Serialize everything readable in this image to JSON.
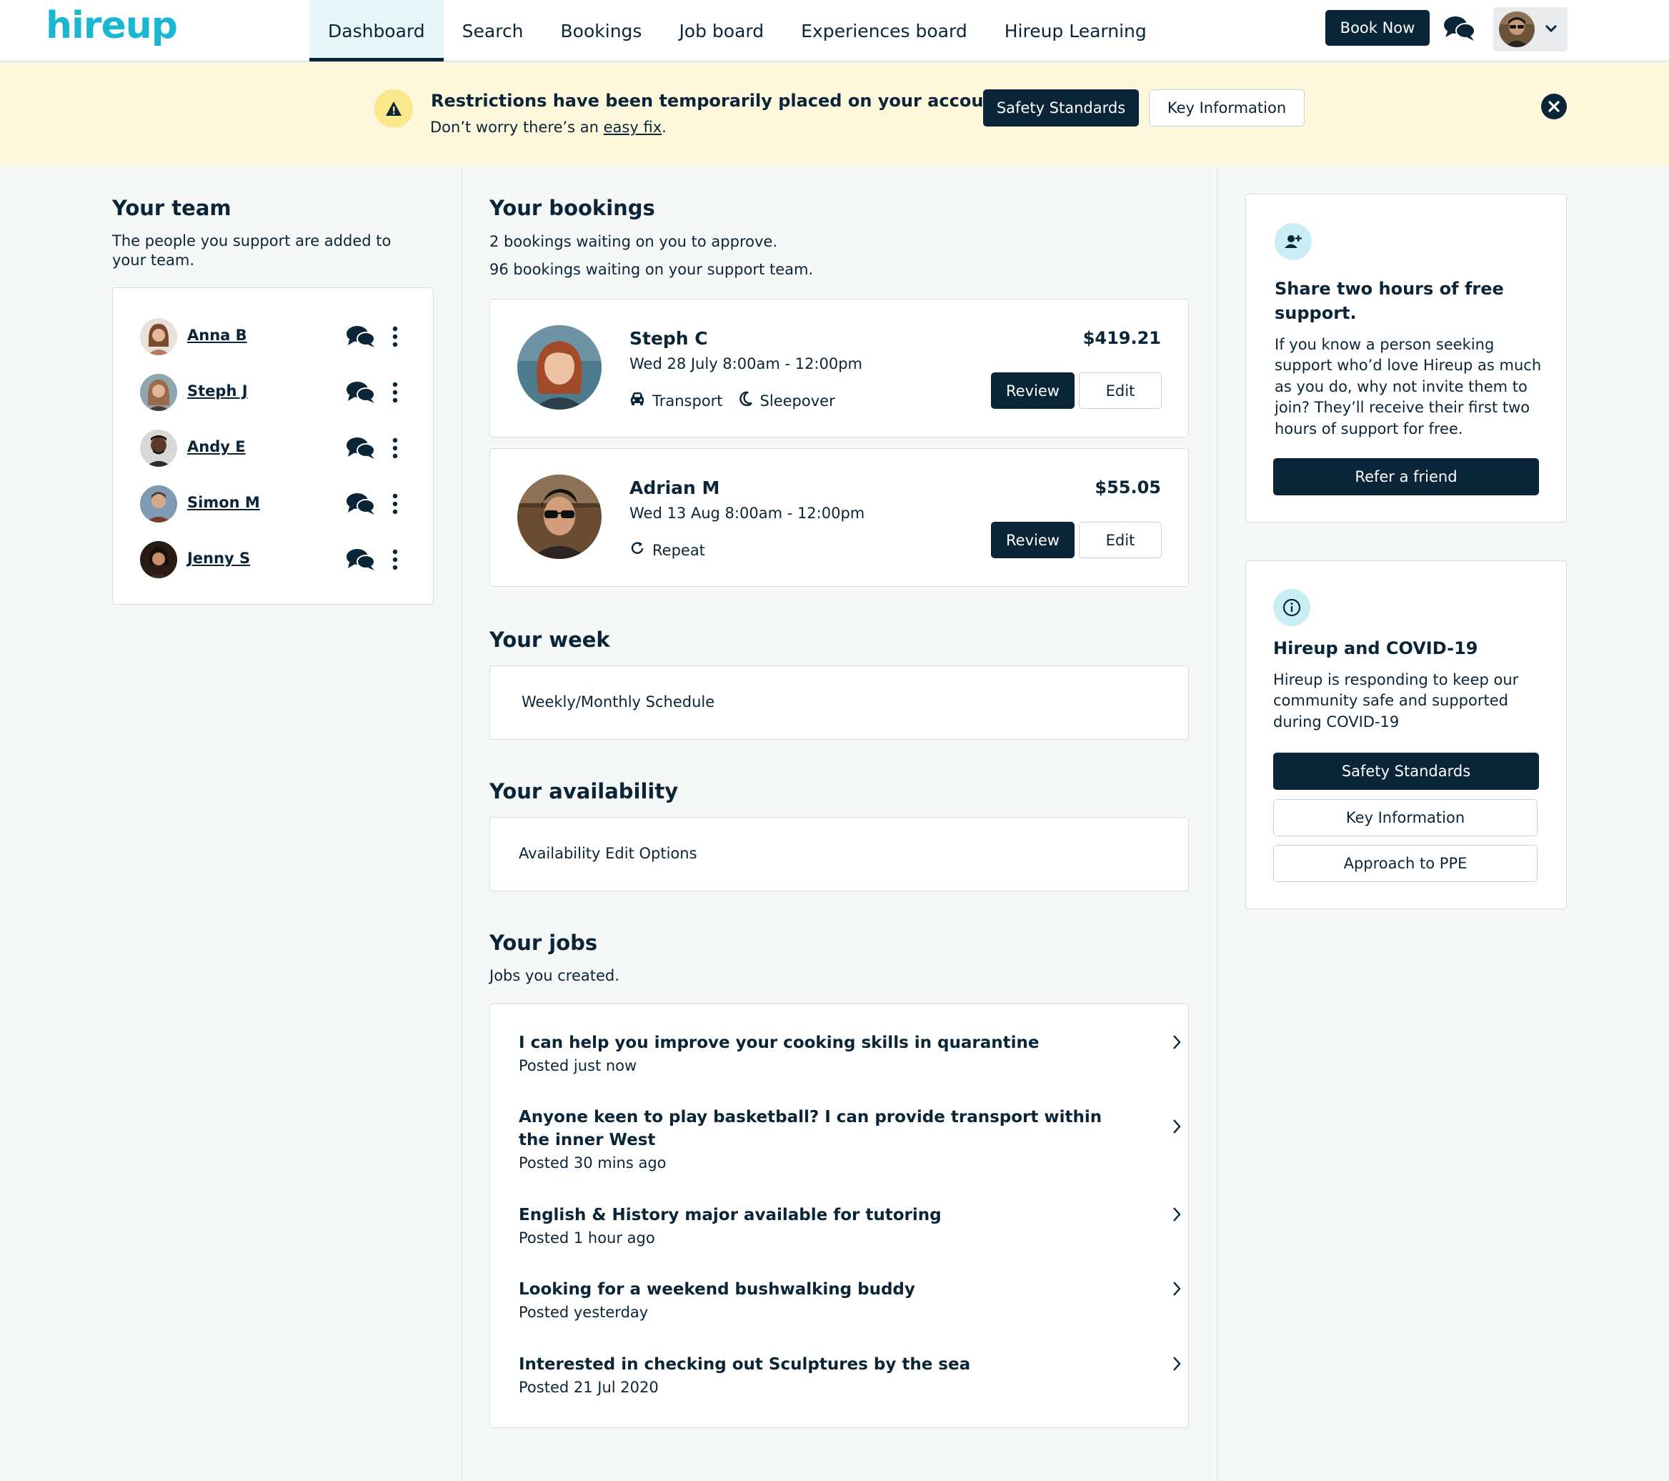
{
  "header": {
    "logo": "hireup",
    "nav": [
      "Dashboard",
      "Search",
      "Bookings",
      "Job board",
      "Experiences board",
      "Hireup Learning"
    ],
    "active_nav": "Dashboard",
    "book_now": "Book Now"
  },
  "banner": {
    "title": "Restrictions have been temporarily placed on your account.",
    "sub_prefix": "Don’t worry there’s an ",
    "sub_link": "easy fix",
    "sub_suffix": ".",
    "safety_button": "Safety Standards",
    "key_button": "Key Information"
  },
  "team": {
    "title": "Your team",
    "description": "The people you support are added to your team.",
    "members": [
      "Anna B",
      "Steph J",
      "Andy E",
      "Simon M",
      "Jenny S"
    ]
  },
  "bookings": {
    "title": "Your bookings",
    "line1": "2 bookings waiting on you to approve.",
    "line2": "96 bookings waiting on your support team.",
    "items": [
      {
        "name": "Steph C",
        "date": "Wed 28 July  8:00am - 12:00pm",
        "price": "$419.21",
        "tags": [
          "Transport",
          "Sleepover"
        ],
        "review": "Review",
        "edit": "Edit"
      },
      {
        "name": "Adrian M",
        "date": "Wed 13 Aug  8:00am - 12:00pm",
        "price": "$55.05",
        "tags": [
          "Repeat"
        ],
        "review": "Review",
        "edit": "Edit"
      }
    ]
  },
  "week": {
    "title": "Your week",
    "content": "Weekly/Monthly Schedule"
  },
  "availability": {
    "title": "Your availability",
    "content": "Availability Edit Options"
  },
  "jobs": {
    "title": "Your jobs",
    "description": "Jobs you created.",
    "items": [
      {
        "title": "I can help you improve your cooking skills in quarantine",
        "posted": "Posted just now"
      },
      {
        "title": "Anyone keen to play basketball? I can provide transport within the inner West",
        "posted": "Posted 30 mins ago"
      },
      {
        "title": "English & History major available for tutoring",
        "posted": "Posted 1 hour ago"
      },
      {
        "title": "Looking for a weekend bushwalking buddy",
        "posted": "Posted yesterday"
      },
      {
        "title": "Interested in checking out Sculptures by the sea",
        "posted": "Posted 21 Jul 2020"
      }
    ]
  },
  "refer": {
    "title": "Share two hours of free support.",
    "text": "If you know a person seeking support who’d love Hireup as much as you do, why not invite them to join? They’ll receive their first two hours of support for free.",
    "button": "Refer a friend"
  },
  "covid": {
    "title": "Hireup and COVID-19",
    "text": "Hireup is responding to keep our community safe and supported during COVID-19",
    "buttons": [
      "Safety Standards",
      "Key Information",
      "Approach to PPE"
    ]
  },
  "colors": {
    "navy": "#0b2538",
    "brand": "#1bb6d1",
    "banner_bg": "#fdf7dc",
    "page_bg": "#f6f7f7"
  }
}
